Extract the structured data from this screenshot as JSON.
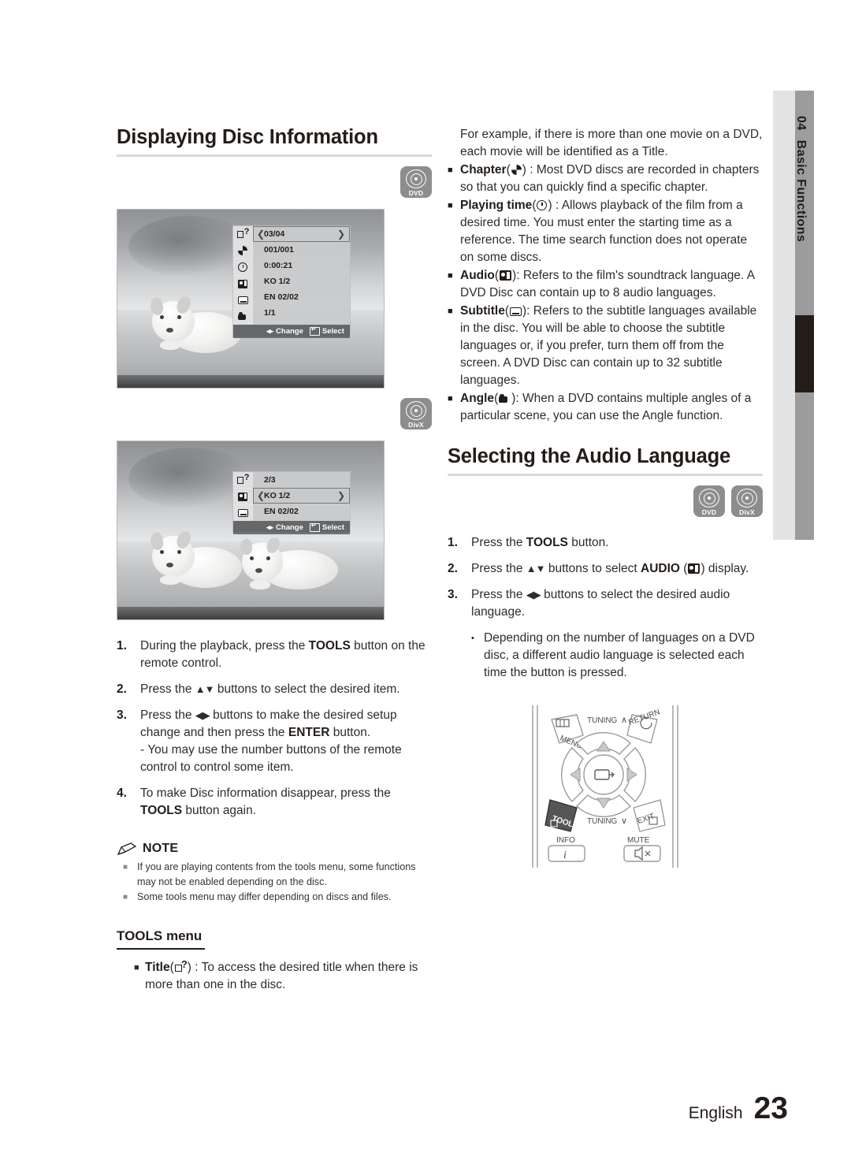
{
  "chapter_tab": {
    "number": "04",
    "label": "Basic Functions"
  },
  "left": {
    "heading": "Displaying Disc Information",
    "badge_dvd": {
      "icon": "dvd-disc-icon",
      "label": "DVD"
    },
    "badge_divx": {
      "icon": "divx-disc-icon",
      "label": "DivX"
    },
    "osd1": {
      "rows": [
        {
          "icon": "title-icon",
          "value": "03/04",
          "selected": true
        },
        {
          "icon": "chapter-icon",
          "value": "001/001",
          "selected": false
        },
        {
          "icon": "playing-time-icon",
          "value": "0:00:21",
          "selected": false
        },
        {
          "icon": "audio-icon",
          "value": "KO 1/2",
          "selected": false
        },
        {
          "icon": "subtitle-icon",
          "value": "EN 02/02",
          "selected": false
        },
        {
          "icon": "angle-icon",
          "value": "1/1",
          "selected": false
        }
      ],
      "footer": {
        "change": "Change",
        "select": "Select"
      }
    },
    "osd2": {
      "rows": [
        {
          "icon": "title-icon",
          "value": "2/3",
          "selected": false
        },
        {
          "icon": "audio-icon",
          "value": "KO 1/2",
          "selected": true
        },
        {
          "icon": "subtitle-icon",
          "value": "EN 02/02",
          "selected": false
        }
      ],
      "footer": {
        "change": "Change",
        "select": "Select"
      }
    },
    "steps": [
      {
        "n": "1.",
        "html": "During the playback, press the <b>TOOLS</b> button on the remote control."
      },
      {
        "n": "2.",
        "html": "Press the <span class=\"arrows\">▲▼</span> buttons to select the desired item."
      },
      {
        "n": "3.",
        "html": "Press the <span class=\"arrows\">◀▶</span> buttons to make the desired setup change and then press the <b>ENTER</b> button.<span class=\"sub-line\">- You may use the number buttons of the remote control to control some item.</span>"
      },
      {
        "n": "4.",
        "html": "To make Disc information disappear, press the <b>TOOLS</b> button again."
      }
    ],
    "note": {
      "title": "NOTE",
      "items": [
        "If you are playing contents from the tools menu, some functions may not be enabled depending on the disc.",
        "Some tools menu may differ depending on discs and files."
      ]
    },
    "tools_menu": {
      "heading": "TOOLS menu",
      "items": [
        {
          "html": "<b>Title</b>(<span class=\"iic title\"></span>) : To access the desired title when there is more than one in the disc."
        }
      ]
    }
  },
  "right": {
    "intro": "For example, if there is more than one movie on a DVD, each movie will be identified as a Title.",
    "bullets": [
      {
        "html": "<b>Chapter</b>(<span class=\"iic chap\"></span>) : Most DVD discs are recorded in chapters so that you can quickly find a specific chapter."
      },
      {
        "html": "<b>Playing time</b>(<span class=\"iic time\"></span>) : Allows playback of the film from a desired time. You must enter the starting time as a reference. The time search function does not operate on some discs."
      },
      {
        "html": "<b>Audio</b>(<span class=\"iic audio\"></span>): Refers to the film's soundtrack language. A DVD Disc can contain up to 8 audio languages."
      },
      {
        "html": "<b>Subtitle</b>(<span class=\"iic sub\"></span>): Refers to the subtitle languages available in the disc. You will be able to choose the subtitle languages or, if you prefer, turn them off from the screen. A DVD Disc can contain up to 32 subtitle languages."
      },
      {
        "html": "<b>Angle</b>(<span class=\"iic ang\"></span>): When a DVD contains multiple angles of a particular scene, you can use the Angle function."
      }
    ],
    "heading": "Selecting the Audio Language",
    "badge_dvd": {
      "icon": "dvd-disc-icon",
      "label": "DVD"
    },
    "badge_divx": {
      "icon": "divx-disc-icon",
      "label": "DivX"
    },
    "steps": [
      {
        "n": "1.",
        "html": "Press the <b>TOOLS</b> button."
      },
      {
        "n": "2.",
        "html": "Press the <span class=\"arrows\">▲▼</span> buttons to select <b>AUDIO</b> (<span class=\"iic audio\"></span>) display."
      },
      {
        "n": "3.",
        "html": "Press the <span class=\"arrows\">◀▶</span> buttons to select the desired audio language."
      }
    ],
    "dot_note": "Depending on the number of languages on a DVD disc, a different audio language is selected each time the button is pressed.",
    "remote": {
      "menu": "MENU",
      "tuning_up": "TUNING",
      "return": "RETURN",
      "tools": "TOOLS",
      "tuning_down": "TUNING",
      "exit": "EXIT",
      "info": "INFO",
      "mute": "MUTE"
    }
  },
  "footer": {
    "language": "English",
    "page": "23"
  }
}
